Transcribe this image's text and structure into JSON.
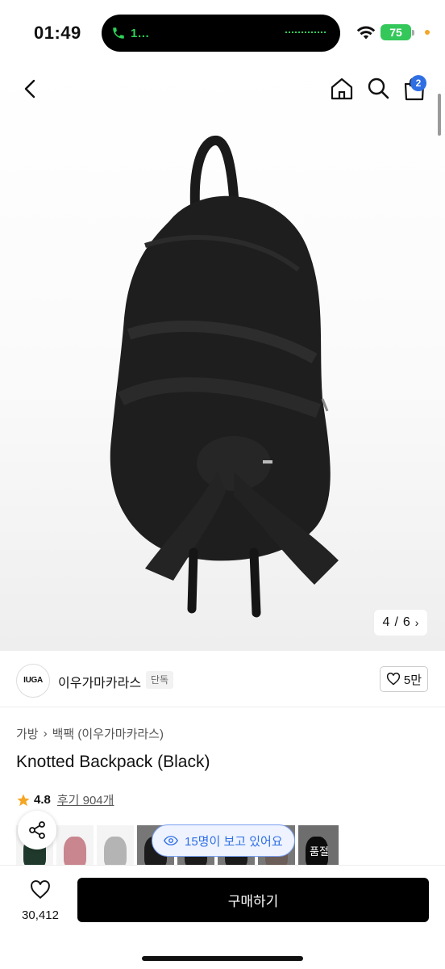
{
  "status_bar": {
    "time": "01:49",
    "call_label": "1…",
    "battery": "75"
  },
  "nav": {
    "cart_count": "2"
  },
  "gallery": {
    "counter_current": "4",
    "counter_separator": "/",
    "counter_total": "6"
  },
  "brand": {
    "logo_text": "IUGA",
    "name": "이우가마카라스",
    "tag": "단독",
    "like_count": "5만"
  },
  "product": {
    "breadcrumb": [
      "가방",
      "백팩 (이우가마카라스)"
    ],
    "title": "Knotted Backpack (Black)",
    "rating": "4.8",
    "reviews_label": "후기 904개"
  },
  "options": {
    "viewers_text": "15명이 보고 있어요",
    "soldout_label": "품절"
  },
  "bottom": {
    "wish_count": "30,412",
    "buy_label": "구매하기"
  },
  "colors": {
    "accent": "#2f6fe4",
    "battery": "#34c759",
    "star": "#f5a623",
    "buy_button": "#000000"
  }
}
